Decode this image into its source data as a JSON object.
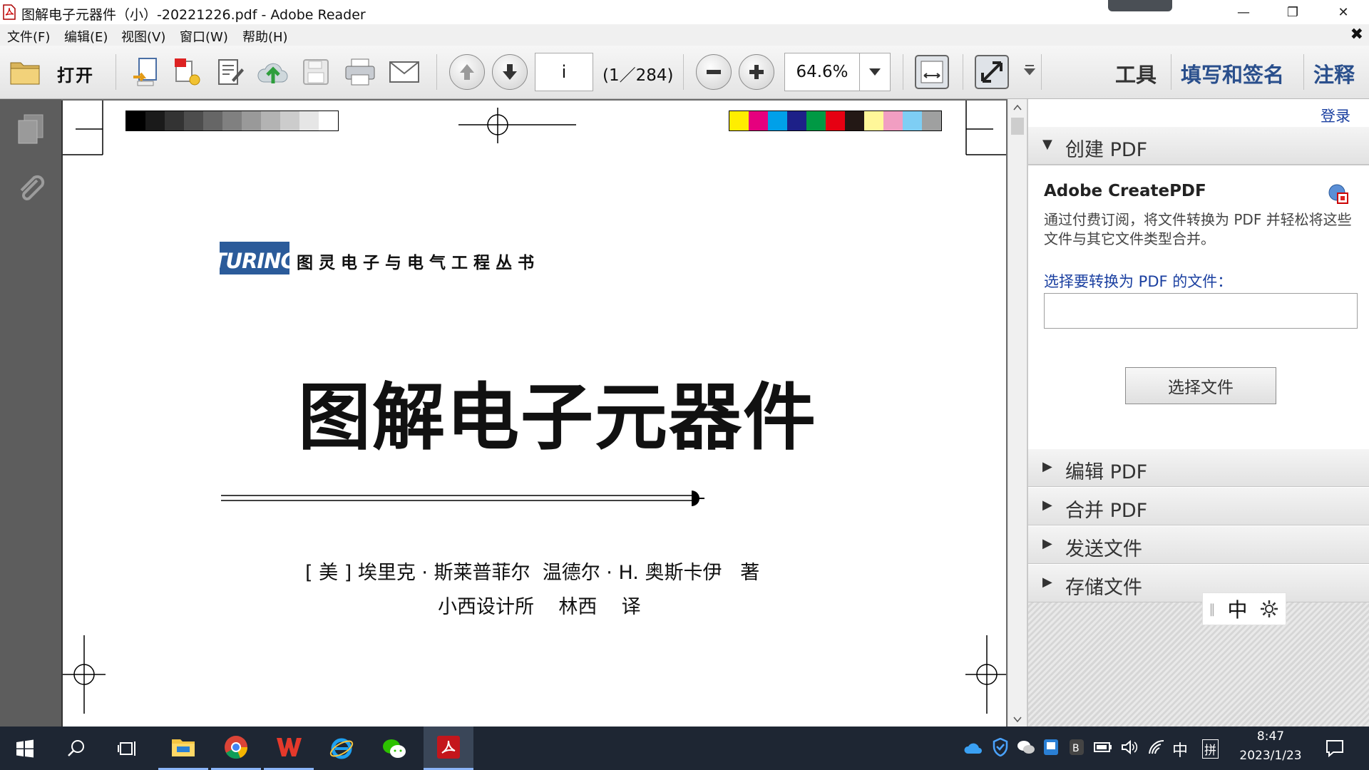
{
  "window": {
    "title": "图解电子元器件（小）-20221226.pdf - Adobe Reader",
    "minimize": "—",
    "maximize": "❐",
    "close": "✕"
  },
  "menu": {
    "items": [
      "文件(F)",
      "编辑(E)",
      "视图(V)",
      "窗口(W)",
      "帮助(H)"
    ],
    "close": "✖"
  },
  "toolbar": {
    "open_label": "打开",
    "page_value": "i",
    "page_count": "(1／284)",
    "zoom_value": "64.6%",
    "right_links": [
      "工具",
      "填写和签名",
      "注释"
    ]
  },
  "document": {
    "series_logo": "TURING",
    "series_name": "图 灵 电 子 与 电 气 工 程 丛 书",
    "book_title": "图解电子元器件",
    "authors": "[ 美 ] 埃里克 · 斯莱普菲尔  温德尔 · H. 奥斯卡伊   著",
    "translators": "小西设计所    林西    译",
    "gray_swatches": [
      "#000000",
      "#1a1a1a",
      "#333333",
      "#4d4d4d",
      "#666666",
      "#808080",
      "#999999",
      "#b3b3b3",
      "#cccccc",
      "#e6e6e6",
      "#ffffff"
    ],
    "color_swatches": [
      "#ffee00",
      "#e6007e",
      "#00a0e9",
      "#1d2088",
      "#009944",
      "#e60012",
      "#231815",
      "#fff799",
      "#f19ec2",
      "#7ecef4",
      "#9fa0a0"
    ]
  },
  "panel": {
    "login": "登录",
    "create_pdf": "创建 PDF",
    "service_title": "Adobe CreatePDF",
    "service_desc": "通过付费订阅，将文件转换为 PDF 并轻松将这些文件与其它文件类型合并。",
    "select_label": "选择要转换为 PDF 的文件：",
    "choose_file_button": "选择文件",
    "sections": [
      "编辑 PDF",
      "合并 PDF",
      "发送文件",
      "存储文件"
    ],
    "ime_char": "中"
  },
  "taskbar": {
    "ime": "中",
    "ime_mode": "拼",
    "time": "8:47",
    "date": "2023/1/23"
  },
  "colors": {
    "accent": "#2a4f8c",
    "link": "#1a3fa0",
    "taskbar_bg": "#1e2633"
  }
}
